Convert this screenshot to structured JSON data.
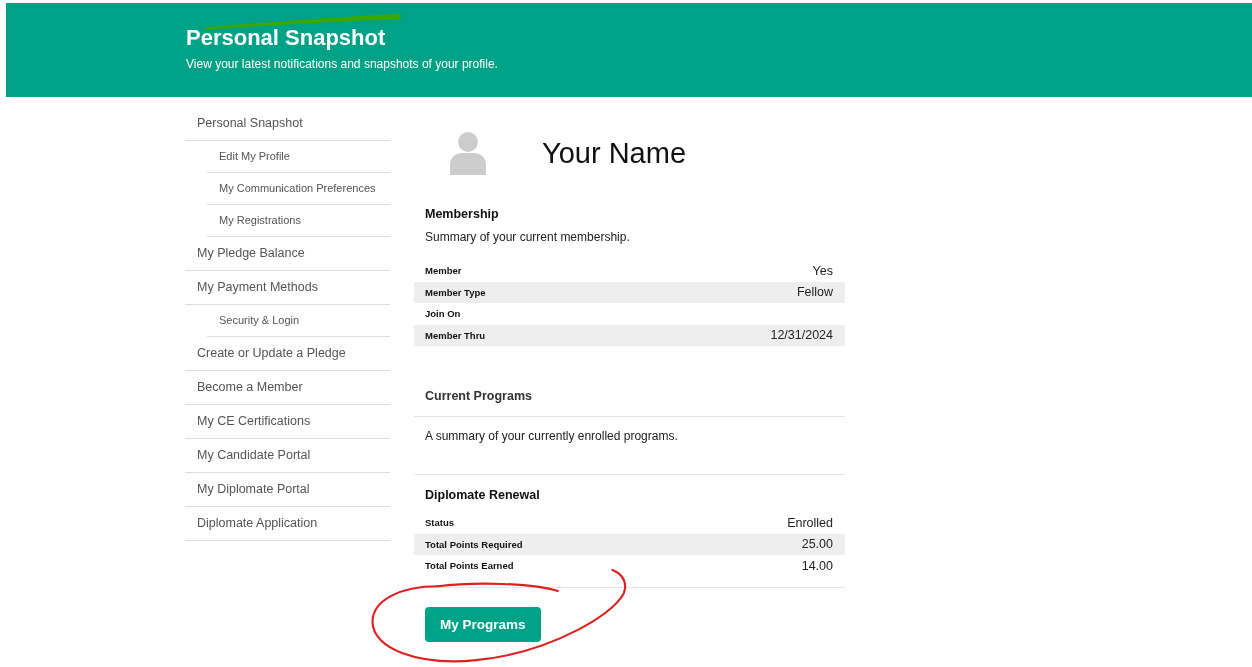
{
  "header": {
    "title": "Personal Snapshot",
    "subtitle": "View your latest notifications and snapshots of your profile."
  },
  "sidebar": {
    "items": [
      {
        "label": "Personal Snapshot",
        "children": [
          {
            "label": "Edit My Profile"
          },
          {
            "label": "My Communication Preferences"
          },
          {
            "label": "My Registrations"
          }
        ]
      },
      {
        "label": "My Pledge Balance"
      },
      {
        "label": "My Payment Methods",
        "children": [
          {
            "label": "Security & Login"
          }
        ]
      },
      {
        "label": "Create or Update a Pledge"
      },
      {
        "label": "Become a Member"
      },
      {
        "label": "My CE Certifications"
      },
      {
        "label": "My Candidate Portal"
      },
      {
        "label": "My Diplomate Portal"
      },
      {
        "label": "Diplomate Application"
      }
    ]
  },
  "profile": {
    "name": "Your Name"
  },
  "membership": {
    "title": "Membership",
    "summary": "Summary of your current membership.",
    "rows": [
      {
        "label": "Member",
        "value": "Yes"
      },
      {
        "label": "Member Type",
        "value": "Fellow"
      },
      {
        "label": "Join On"
      },
      {
        "label": "Member Thru",
        "value": "12/31/2024"
      }
    ]
  },
  "current_programs": {
    "title": "Current Programs",
    "summary": "A summary of your currently enrolled programs."
  },
  "diplomate_renewal": {
    "title": "Diplomate Renewal",
    "rows": [
      {
        "label": "Status",
        "value": "Enrolled"
      },
      {
        "label": "Total Points Required",
        "value": "25.00"
      },
      {
        "label": "Total Points Earned",
        "value": "14.00"
      }
    ]
  },
  "button": {
    "label": "My Programs"
  }
}
